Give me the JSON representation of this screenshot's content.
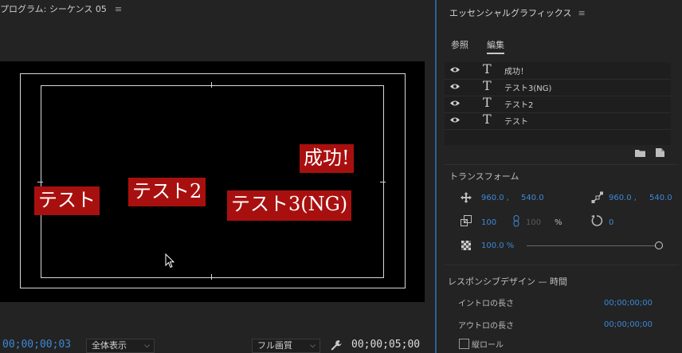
{
  "monitor": {
    "title": "プログラム: シーケンス 05",
    "menu_glyph": "≡",
    "titles": {
      "success": "成功!",
      "test": "テスト",
      "test2": "テスト2",
      "test3": "テスト3(NG)"
    },
    "current_timecode": "00;00;00;03",
    "zoom": "全体表示",
    "quality": "フル画質",
    "duration_timecode": "00;00;05;00"
  },
  "essential_graphics": {
    "title": "エッセンシャルグラフィックス",
    "menu_glyph": "≡",
    "tabs": [
      "参照",
      "編集"
    ],
    "active_tab": "編集",
    "layers": [
      {
        "name": "成功！"
      },
      {
        "name": "テスト3(NG)"
      },
      {
        "name": "テスト2"
      },
      {
        "name": "テスト"
      }
    ],
    "transform": {
      "title": "トランスフォーム",
      "position_x": "960.0 ,",
      "position_y": "540.0",
      "anchor_x": "960.0 ,",
      "anchor_y": "540.0",
      "scale": "100",
      "scale_linked": "100",
      "scale_unit": "%",
      "rotation": "0",
      "opacity": "100.0 %"
    },
    "responsive": {
      "title": "レスポンシブデザイン — 時間",
      "intro_label": "イントロの長さ",
      "intro_value": "00;00;00;00",
      "outro_label": "アウトロの長さ",
      "outro_value": "00;00;00;00",
      "roll_label": "縦ロール"
    }
  }
}
